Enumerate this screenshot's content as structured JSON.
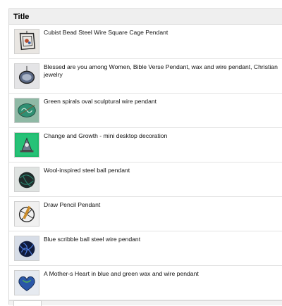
{
  "table": {
    "header": "Title",
    "rows": [
      {
        "title": "Cubist Bead Steel Wire Square Cage Pendant",
        "thumb_icon": "cage-pendant-image"
      },
      {
        "title": "Blessed are you among Women, Bible Verse Pendant, wax and wire pendant, Christian jewelry",
        "thumb_icon": "oval-pendant-image"
      },
      {
        "title": "Green spirals oval sculptural wire pendant",
        "thumb_icon": "green-spiral-pendant-image"
      },
      {
        "title": "Change and Growth - mini desktop decoration",
        "thumb_icon": "desktop-decoration-image"
      },
      {
        "title": "Wool-inspired steel ball pendant",
        "thumb_icon": "steel-ball-pendant-image"
      },
      {
        "title": "Draw Pencil Pendant",
        "thumb_icon": "pencil-pendant-image"
      },
      {
        "title": "Blue scribble ball steel wire pendant",
        "thumb_icon": "blue-scribble-pendant-image"
      },
      {
        "title": "A Mother-s Heart in blue and green wax and wire pendant",
        "thumb_icon": "heart-pendant-image"
      }
    ]
  }
}
